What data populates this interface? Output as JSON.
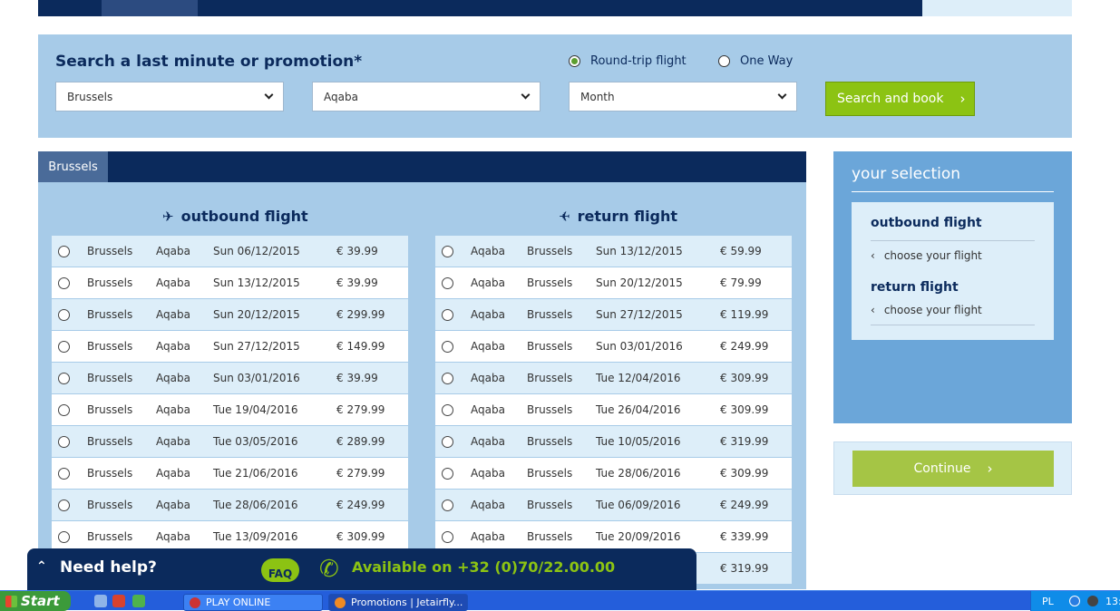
{
  "search": {
    "title": "Search a last minute or promotion*",
    "trip_types": [
      {
        "label": "Round-trip flight",
        "selected": true
      },
      {
        "label": "One Way",
        "selected": false
      }
    ],
    "from_value": "Brussels",
    "to_value": "Aqaba",
    "month_value": "Month",
    "button_label": "Search and book",
    "button_arrow": "›"
  },
  "panel": {
    "tab": "Brussels",
    "outbound_title": "outbound flight",
    "return_title": "return flight",
    "outbound": [
      {
        "from": "Brussels",
        "to": "Aqaba",
        "date": "Sun 06/12/2015",
        "price": "€ 39.99"
      },
      {
        "from": "Brussels",
        "to": "Aqaba",
        "date": "Sun 13/12/2015",
        "price": "€ 39.99"
      },
      {
        "from": "Brussels",
        "to": "Aqaba",
        "date": "Sun 20/12/2015",
        "price": "€ 299.99"
      },
      {
        "from": "Brussels",
        "to": "Aqaba",
        "date": "Sun 27/12/2015",
        "price": "€ 149.99"
      },
      {
        "from": "Brussels",
        "to": "Aqaba",
        "date": "Sun 03/01/2016",
        "price": "€ 39.99"
      },
      {
        "from": "Brussels",
        "to": "Aqaba",
        "date": "Tue 19/04/2016",
        "price": "€ 279.99"
      },
      {
        "from": "Brussels",
        "to": "Aqaba",
        "date": "Tue 03/05/2016",
        "price": "€ 289.99"
      },
      {
        "from": "Brussels",
        "to": "Aqaba",
        "date": "Tue 21/06/2016",
        "price": "€ 279.99"
      },
      {
        "from": "Brussels",
        "to": "Aqaba",
        "date": "Tue 28/06/2016",
        "price": "€ 249.99"
      },
      {
        "from": "Brussels",
        "to": "Aqaba",
        "date": "Tue 13/09/2016",
        "price": "€ 309.99"
      }
    ],
    "return": [
      {
        "from": "Aqaba",
        "to": "Brussels",
        "date": "Sun 13/12/2015",
        "price": "€ 59.99"
      },
      {
        "from": "Aqaba",
        "to": "Brussels",
        "date": "Sun 20/12/2015",
        "price": "€ 79.99"
      },
      {
        "from": "Aqaba",
        "to": "Brussels",
        "date": "Sun 27/12/2015",
        "price": "€ 119.99"
      },
      {
        "from": "Aqaba",
        "to": "Brussels",
        "date": "Sun 03/01/2016",
        "price": "€ 249.99"
      },
      {
        "from": "Aqaba",
        "to": "Brussels",
        "date": "Tue 12/04/2016",
        "price": "€ 309.99"
      },
      {
        "from": "Aqaba",
        "to": "Brussels",
        "date": "Tue 26/04/2016",
        "price": "€ 309.99"
      },
      {
        "from": "Aqaba",
        "to": "Brussels",
        "date": "Tue 10/05/2016",
        "price": "€ 319.99"
      },
      {
        "from": "Aqaba",
        "to": "Brussels",
        "date": "Tue 28/06/2016",
        "price": "€ 309.99"
      },
      {
        "from": "Aqaba",
        "to": "Brussels",
        "date": "Tue 06/09/2016",
        "price": "€ 249.99"
      },
      {
        "from": "Aqaba",
        "to": "Brussels",
        "date": "Tue 20/09/2016",
        "price": "€ 339.99"
      },
      {
        "from": "",
        "to": "",
        "date": "",
        "price": "€ 319.99"
      }
    ]
  },
  "selection": {
    "title": "your selection",
    "outbound_title": "outbound flight",
    "outbound_link": "choose your flight",
    "return_title": "return flight",
    "return_link": "choose your flight",
    "continue_label": "Continue",
    "continue_arrow": "›"
  },
  "help": {
    "title": "Need help?",
    "faq": "FAQ",
    "available": "Available on +32 (0)70/22.00.00"
  },
  "taskbar": {
    "start": "Start",
    "tasks": [
      "PLAY ONLINE",
      "Promotions | Jetairfly..."
    ],
    "lang": "PL",
    "clock": "13:"
  },
  "colors": {
    "navy": "#0b2a5c",
    "light_blue": "#a7cbe8",
    "pale_blue": "#ddeef9",
    "green": "#8cc313",
    "selection_blue": "#6ba6d9"
  }
}
